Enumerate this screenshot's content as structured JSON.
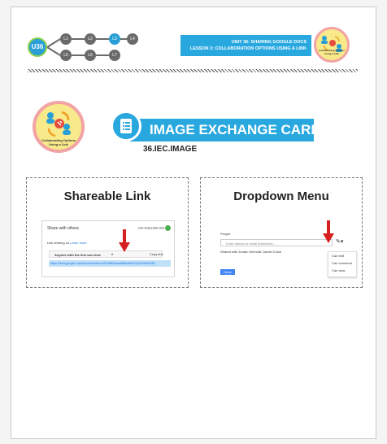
{
  "header": {
    "unit_badge": "U36",
    "lessons": [
      "L1",
      "L2",
      "L3",
      "L4",
      "L5",
      "L6",
      "L7"
    ],
    "active_lesson": "L3",
    "banner_line1": "UNIT 36:  SHARING GOOGLE DOCS",
    "banner_line2": "LESSON 3: COLLABORATION OPTIONS USING A LINK",
    "badge_caption": "Collaborating Options Using a Link"
  },
  "title": {
    "badge_caption": "Collaborating Options Using a Link",
    "heading": "IMAGE EXCHANGE CARDS",
    "code": "36.IEC.IMAGE"
  },
  "cards": {
    "left": {
      "title": "Shareable Link",
      "share_with_others": "Share with others",
      "get_link": "Get shareable link",
      "sharing_on": "Link sharing on",
      "learn_more": "Learn more",
      "anyone_can_view": "Anyone with the link can view",
      "copy_link": "Copy link",
      "url": "https://docs.google.com/document/d/1xrJ2FwMMOaw8fI8bcs0hZUryVZhk2HHSk"
    },
    "right": {
      "title": "Dropdown Menu",
      "people_label": "People",
      "input_placeholder": "Enter names or email addresses...",
      "shared_with": "Shared with Jordan Schmidt, Daniel Colon",
      "done": "Done",
      "menu_items": [
        "Can edit",
        "Can comment",
        "Can view"
      ]
    }
  },
  "colors": {
    "accent": "#29a8e0",
    "arrow": "#d62020",
    "badge_fill": "#f8e98a",
    "badge_ring": "#f2a3a3"
  }
}
